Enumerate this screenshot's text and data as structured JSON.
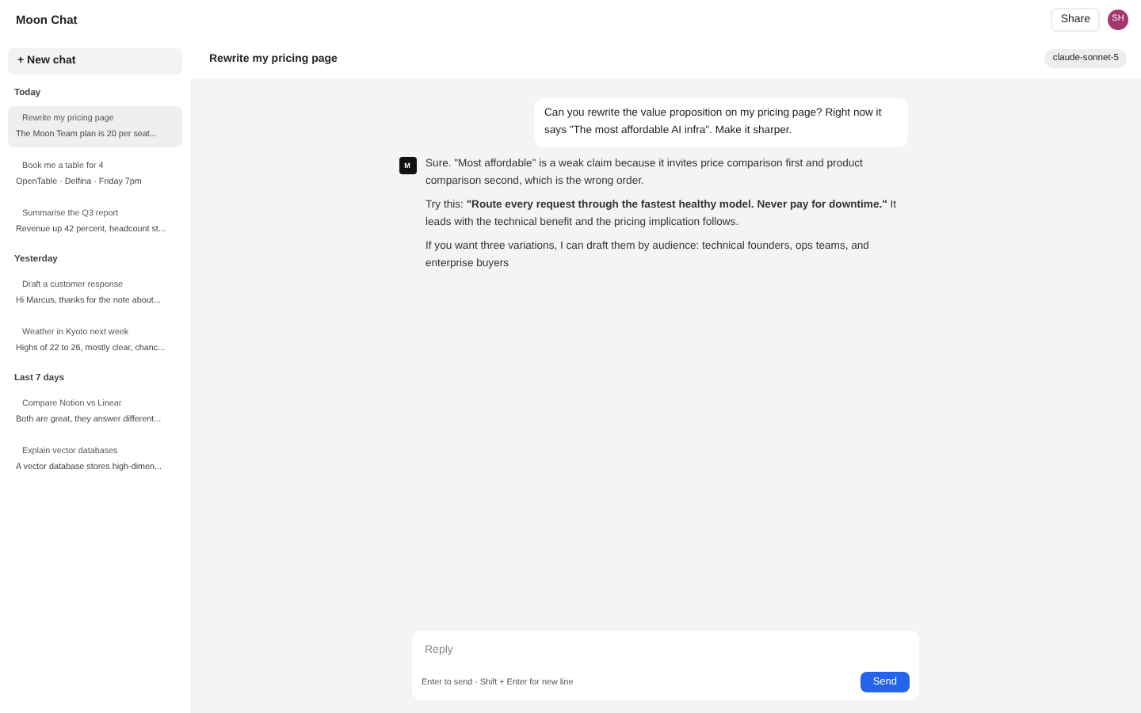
{
  "app": {
    "title": "Moon Chat",
    "share": "Share",
    "avatar": "SH"
  },
  "sidebar": {
    "new_chat": "+ New chat",
    "groups": [
      {
        "label": "Today",
        "items": [
          {
            "title": "Rewrite my pricing page",
            "preview": "The Moon Team plan is 20 per seat...",
            "selected": true
          },
          {
            "title": "Book me a table for 4",
            "preview": "OpenTable · Delfina · Friday 7pm",
            "selected": false
          },
          {
            "title": "Summarise the Q3 report",
            "preview": "Revenue up 42 percent, headcount st...",
            "selected": false
          }
        ]
      },
      {
        "label": "Yesterday",
        "items": [
          {
            "title": "Draft a customer response",
            "preview": "Hi Marcus, thanks for the note about...",
            "selected": false
          },
          {
            "title": "Weather in Kyoto next week",
            "preview": "Highs of 22 to 26, mostly clear, chanc...",
            "selected": false
          }
        ]
      },
      {
        "label": "Last 7 days",
        "items": [
          {
            "title": "Compare Notion vs Linear",
            "preview": "Both are great, they answer different...",
            "selected": false
          },
          {
            "title": "Explain vector databases",
            "preview": "A vector database stores high-dimen...",
            "selected": false
          }
        ]
      }
    ]
  },
  "chat": {
    "title": "Rewrite my pricing page",
    "model": "claude-sonnet-5",
    "messages": [
      {
        "kind": "user",
        "paragraphs": [
          "Can you rewrite the value proposition on my pricing page? Right now it says \"The most affordable AI infra\". Make it sharper."
        ]
      },
      {
        "kind": "assistant",
        "avatar": "M",
        "paragraphs": [
          "Sure. \"Most affordable\" is a weak claim because it invites price comparison first and product comparison second, which is the wrong order.",
          "Try this: **\"Route every request through the fastest healthy model. Never pay for downtime.\"** It leads with the technical benefit and the pricing implication follows.",
          "If you want three variations, I can draft them by audience: technical founders, ops teams, and enterprise buyers"
        ]
      }
    ]
  },
  "composer": {
    "placeholder": "Reply",
    "hint": "Enter to send · Shift + Enter for new line",
    "send": "Send"
  }
}
